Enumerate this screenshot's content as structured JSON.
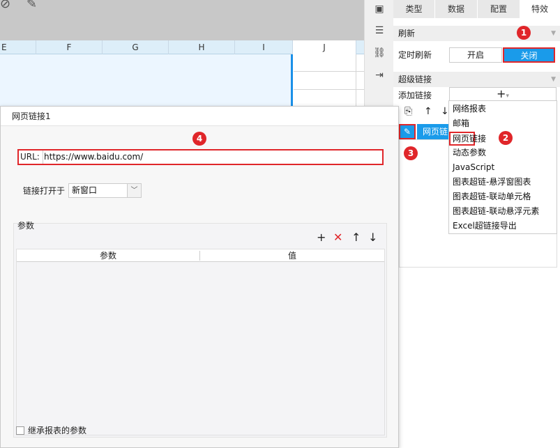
{
  "sheet": {
    "columns": [
      "E",
      "F",
      "G",
      "H",
      "I",
      "J"
    ]
  },
  "side_toolbar": {
    "icons": [
      "widget-icon",
      "layers-icon",
      "link-icon",
      "import-icon"
    ]
  },
  "panel": {
    "tabs": [
      "类型",
      "数据",
      "配置",
      "特效"
    ],
    "refresh": {
      "header": "刷新",
      "timer_label": "定时刷新",
      "on_label": "开启",
      "off_label": "关闭"
    },
    "hyperlink": {
      "header": "超级链接",
      "add_label": "添加链接",
      "add_symbol": "+",
      "add_caret": "▾",
      "item_label": "网页链"
    }
  },
  "dropdown": {
    "items": [
      "网络报表",
      "邮箱",
      "网页链接",
      "动态参数",
      "JavaScript",
      "图表超链-悬浮窗图表",
      "图表超链-联动单元格",
      "图表超链-联动悬浮元素",
      "Excel超链接导出"
    ]
  },
  "dialog": {
    "title": "网页链接1",
    "url_label": "URL:",
    "url_value": "https://www.baidu.com/",
    "open_in_label": "链接打开于",
    "open_in_value": "新窗口",
    "params_section": "参数",
    "params_columns": [
      "参数",
      "值"
    ],
    "inherit_label": "继承报表的参数"
  },
  "badges": [
    "1",
    "2",
    "3",
    "4"
  ],
  "colors": {
    "accent": "#1a9bea",
    "highlight_red": "#e0262a",
    "sheet_selection": "#ecf6ff"
  }
}
